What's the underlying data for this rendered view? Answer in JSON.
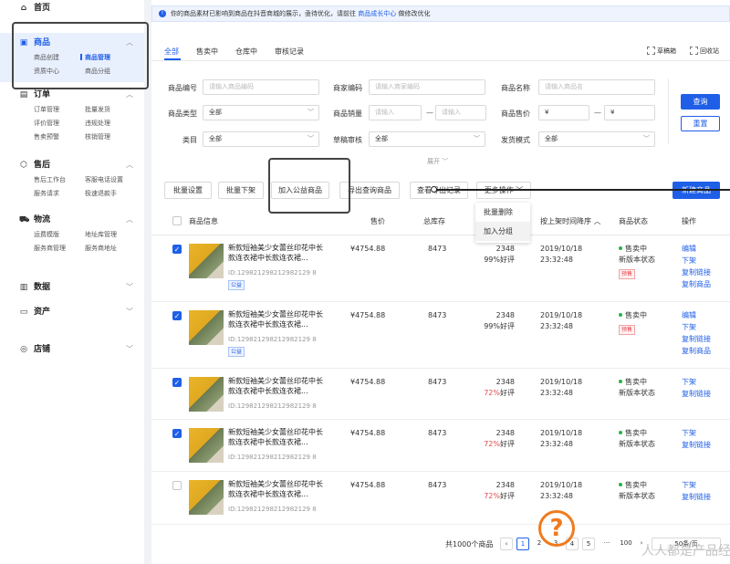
{
  "sidebar": {
    "home": "首页",
    "goods": {
      "title": "商品",
      "items": [
        "商品创建",
        "商品管理",
        "资质中心",
        "商品分组"
      ]
    },
    "orders": {
      "title": "订单",
      "items": [
        "订单管理",
        "批量发货",
        "评价管理",
        "违规处理",
        "售卖预警",
        "核销管理"
      ]
    },
    "aftersale": {
      "title": "售后",
      "items": [
        "售后工作台",
        "客服电话设置",
        "服务请求",
        "极速退款手"
      ]
    },
    "logistics": {
      "title": "物流",
      "items": [
        "运费模版",
        "地址库管理",
        "服务商管理",
        "服务商地址"
      ]
    },
    "data": {
      "title": "数据"
    },
    "assets": {
      "title": "资产"
    },
    "shop": {
      "title": "店铺"
    }
  },
  "notice": {
    "text": "你的商品素材已影响到商品在抖音商城的展示，亟待优化，请前往",
    "link": "商品成长中心",
    "tail": "做修改优化"
  },
  "tabs": [
    "全部",
    "售卖中",
    "仓库中",
    "审核记录"
  ],
  "top_actions": [
    "草稿箱",
    "回收站"
  ],
  "filters": {
    "code_label": "商品编号",
    "code_ph": "请输入商品编码",
    "mcode_label": "商家编码",
    "mcode_ph": "请输入商家编码",
    "name_label": "商品名称",
    "name_ph": "请输入商品名",
    "type_label": "商品类型",
    "type_val": "全部",
    "sales_label": "商品销量",
    "sales_ph1": "请输入",
    "sales_ph2": "请输入",
    "price_label": "商品售价",
    "price_ph1": "¥",
    "price_ph2": "¥",
    "cat_label": "类目",
    "cat_val": "全部",
    "draft_label": "草稿审核",
    "draft_val": "全部",
    "ship_label": "发货模式",
    "ship_val": "全部",
    "dash": "—",
    "query": "查询",
    "reset": "重置",
    "expand": "展开 ﹀"
  },
  "actions": [
    "批量设置",
    "批量下架",
    "加入公益商品",
    "导出查询商品",
    "查看导出记录",
    "更多操作 ﹀"
  ],
  "new_goods": "新建商品",
  "dropdown": [
    "批量删除",
    "加入分组"
  ],
  "table": {
    "headers": [
      "商品信息",
      "售价",
      "总库存",
      "销量",
      "按上架时间降序 ︿",
      "商品状态",
      "操作"
    ],
    "rows": [
      {
        "checked": true,
        "name": "新款短袖美少女蕾丝印花中长款连衣裙中长款连衣裙...",
        "id": "ID:129821298212982129 8",
        "tag": "公益",
        "price": "¥4754.88",
        "stock": "8473",
        "sales": "2348",
        "rate": "99%",
        "rate_suffix": "好评",
        "date": "2019/10/18",
        "time": "23:32:48",
        "status": "售卖中",
        "substatus": "新版本状态",
        "ptag": "预售",
        "ops": [
          "编辑",
          "下架",
          "复制链接",
          "复制商品"
        ]
      },
      {
        "checked": true,
        "name": "新款短袖美少女蕾丝印花中长款连衣裙中长款连衣裙...",
        "id": "ID:129821298212982129 8",
        "tag": "公益",
        "price": "¥4754.88",
        "stock": "8473",
        "sales": "2348",
        "rate": "99%",
        "rate_suffix": "好评",
        "date": "2019/10/18",
        "time": "23:32:48",
        "status": "售卖中",
        "substatus": "",
        "ptag": "预售",
        "ops": [
          "编辑",
          "下架",
          "复制链接",
          "复制商品"
        ]
      },
      {
        "checked": true,
        "name": "新款短袖美少女蕾丝印花中长款连衣裙中长款连衣裙...",
        "id": "ID:129821298212982129 8",
        "tag": "",
        "price": "¥4754.88",
        "stock": "8473",
        "sales": "2348",
        "rate": "72%",
        "rate_suffix": "好评",
        "date": "2019/10/18",
        "time": "23:32:48",
        "status": "售卖中",
        "substatus": "新版本状态",
        "ptag": "",
        "ops": [
          "下架",
          "复制链接"
        ]
      },
      {
        "checked": true,
        "name": "新款短袖美少女蕾丝印花中长款连衣裙中长款连衣裙...",
        "id": "ID:129821298212982129 8",
        "tag": "",
        "price": "¥4754.88",
        "stock": "8473",
        "sales": "2348",
        "rate": "72%",
        "rate_suffix": "好评",
        "date": "2019/10/18",
        "time": "23:32:48",
        "status": "售卖中",
        "substatus": "新版本状态",
        "ptag": "",
        "ops": [
          "下架",
          "复制链接"
        ]
      },
      {
        "checked": false,
        "name": "新款短袖美少女蕾丝印花中长款连衣裙中长款连衣裙...",
        "id": "ID:129821298212982129 8",
        "tag": "",
        "price": "¥4754.88",
        "stock": "8473",
        "sales": "2348",
        "rate": "72%",
        "rate_suffix": "好评",
        "date": "2019/10/18",
        "time": "23:32:48",
        "status": "售卖中",
        "substatus": "新版本状态",
        "ptag": "",
        "ops": [
          "下架",
          "复制链接"
        ]
      }
    ]
  },
  "pager": {
    "total": "共1000个商品",
    "prev": "‹",
    "pages": [
      "1",
      "2",
      "3",
      "4",
      "5"
    ],
    "ellipsis": "···",
    "last": "100",
    "next": "›",
    "size": "50条/页"
  },
  "overlay": {
    "qmark": "?",
    "watermark": "人人都是产品经理"
  },
  "colors": {
    "accent": "#1f5fe8",
    "success": "#27b148",
    "danger": "#e5484d",
    "warning": "#f07a1d"
  }
}
